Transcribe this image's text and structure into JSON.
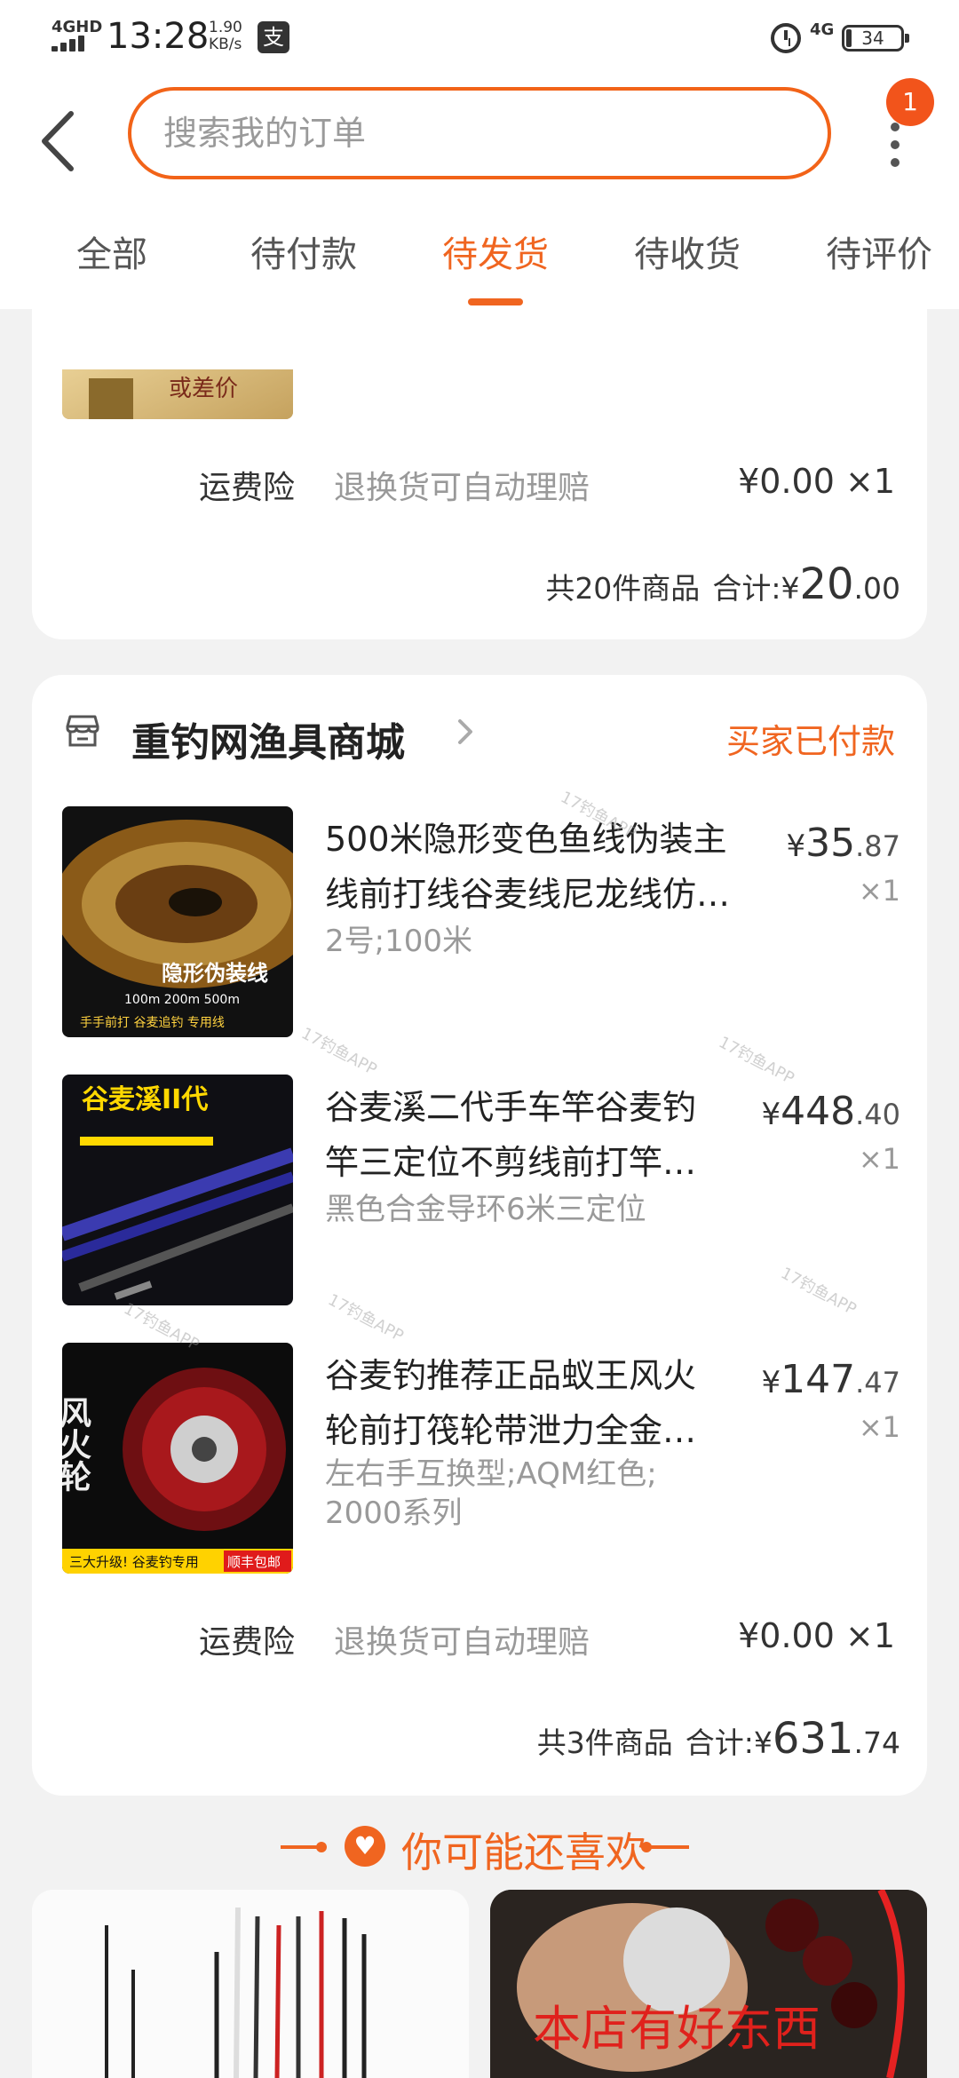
{
  "status_bar": {
    "network": "4GHD",
    "time": "13:28",
    "speed_value": "1.90",
    "speed_unit": "KB/s",
    "pay_icon_char": "支",
    "network_right": "4G",
    "battery": "34"
  },
  "search": {
    "placeholder": "搜索我的订单"
  },
  "more_badge": "1",
  "tabs": [
    {
      "label": "全部"
    },
    {
      "label": "待付款"
    },
    {
      "label": "待发货"
    },
    {
      "label": "待收货"
    },
    {
      "label": "待评价"
    }
  ],
  "active_tab": "待发货",
  "previous_order": {
    "insurance": {
      "label": "运费险",
      "desc": "退换货可自动理赔",
      "price": "¥0.00 ×1"
    },
    "total": {
      "count_text": "共20件商品",
      "label": "合计:",
      "currency": "¥",
      "integer": "20",
      "decimal": ".00"
    }
  },
  "order": {
    "shop_name": "重钓网渔具商城",
    "status": "买家已付款",
    "items": [
      {
        "title_line1": "500米隐形变色鱼线伪装主",
        "title_line2": "线前打线谷麦线尼龙线仿…",
        "spec_line1": "2号;100米",
        "spec_line2": "",
        "price_integer": "35",
        "price_decimal": ".87",
        "qty": "×1",
        "thumb_text": "隐形伪装线",
        "thumb_sub": "100m  200m  500m",
        "thumb_foot": "手手前打 谷麦追钓 专用线"
      },
      {
        "title_line1": "谷麦溪二代手车竿谷麦钓",
        "title_line2": "竿三定位不剪线前打竿…",
        "spec_line1": "黑色合金导环6米三定位",
        "spec_line2": "",
        "price_integer": "448",
        "price_decimal": ".40",
        "qty": "×1",
        "thumb_text": "谷麦溪II代"
      },
      {
        "title_line1": "谷麦钓推荐正品蚁王风火",
        "title_line2": "轮前打筏轮带泄力全金…",
        "spec_line1": "左右手互换型;AQM红色;",
        "spec_line2": "2000系列",
        "price_integer": "147",
        "price_decimal": ".47",
        "qty": "×1",
        "thumb_text": "风火轮",
        "thumb_foot": "三大升级! 谷麦钓专用",
        "thumb_badge": "顺丰包邮"
      }
    ],
    "insurance": {
      "label": "运费险",
      "desc": "退换货可自动理赔",
      "price": "¥0.00 ×1"
    },
    "total": {
      "count_text": "共3件商品",
      "label": "合计:",
      "currency": "¥",
      "integer": "631",
      "decimal": ".74"
    }
  },
  "recommend": {
    "title": "你可能还喜欢",
    "right_overlay": "本店有好东西"
  },
  "watermark": "17钓鱼APP",
  "colors": {
    "accent": "#f06520",
    "badge": "#f2541b",
    "background": "#f2f2f2"
  }
}
